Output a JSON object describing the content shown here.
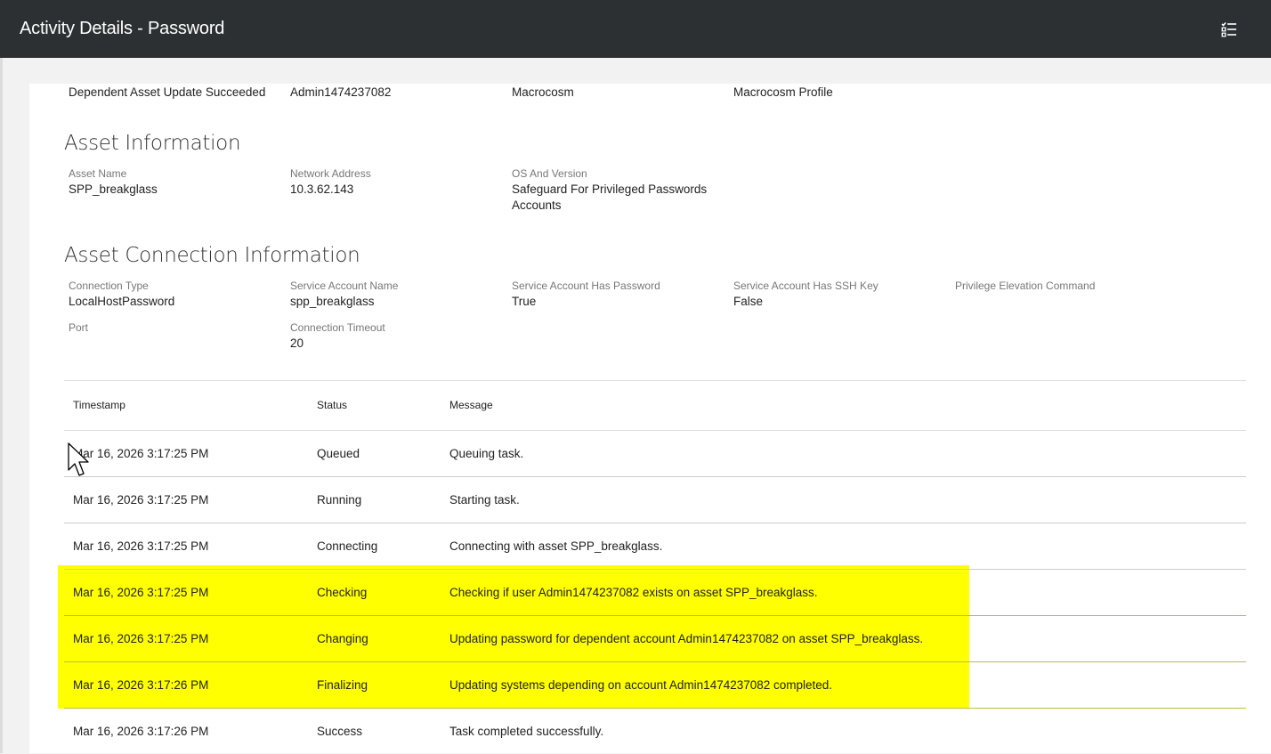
{
  "header": {
    "title": "Activity Details - Password",
    "tasks_icon": "task-list-icon"
  },
  "top_row": {
    "event": "Dependent Asset Update Succeeded",
    "account": "Admin1474237082",
    "partition": "Macrocosm",
    "profile": "Macrocosm Profile"
  },
  "asset_info": {
    "title": "Asset Information",
    "asset_name_label": "Asset Name",
    "asset_name": "SPP_breakglass",
    "network_address_label": "Network Address",
    "network_address": "10.3.62.143",
    "os_label": "OS And Version",
    "os_line1": "Safeguard For Privileged Passwords",
    "os_line2": "Accounts"
  },
  "connection_info": {
    "title": "Asset Connection Information",
    "connection_type_label": "Connection Type",
    "connection_type": "LocalHostPassword",
    "service_account_label": "Service Account Name",
    "service_account": "spp_breakglass",
    "has_password_label": "Service Account Has Password",
    "has_password": "True",
    "has_ssh_label": "Service Account Has SSH Key",
    "has_ssh": "False",
    "privilege_label": "Privilege Elevation Command",
    "port_label": "Port",
    "timeout_label": "Connection Timeout",
    "timeout": "20"
  },
  "table": {
    "headers": {
      "timestamp": "Timestamp",
      "status": "Status",
      "message": "Message"
    },
    "rows": [
      {
        "timestamp": "Mar 16, 2026 3:17:25 PM",
        "status": "Queued",
        "message": "Queuing task."
      },
      {
        "timestamp": "Mar 16, 2026 3:17:25 PM",
        "status": "Running",
        "message": "Starting task."
      },
      {
        "timestamp": "Mar 16, 2026 3:17:25 PM",
        "status": "Connecting",
        "message": "Connecting with asset SPP_breakglass."
      },
      {
        "timestamp": "Mar 16, 2026 3:17:25 PM",
        "status": "Checking",
        "message": "Checking if user Admin1474237082 exists on asset SPP_breakglass."
      },
      {
        "timestamp": "Mar 16, 2026 3:17:25 PM",
        "status": "Changing",
        "message": "Updating password for dependent account Admin1474237082 on asset SPP_breakglass."
      },
      {
        "timestamp": "Mar 16, 2026 3:17:26 PM",
        "status": "Finalizing",
        "message": "Updating systems depending on account Admin1474237082 completed."
      },
      {
        "timestamp": "Mar 16, 2026 3:17:26 PM",
        "status": "Success",
        "message": "Task completed successfully."
      }
    ]
  },
  "colors": {
    "header_bg": "#2c3033",
    "highlight": "#ffff00"
  }
}
